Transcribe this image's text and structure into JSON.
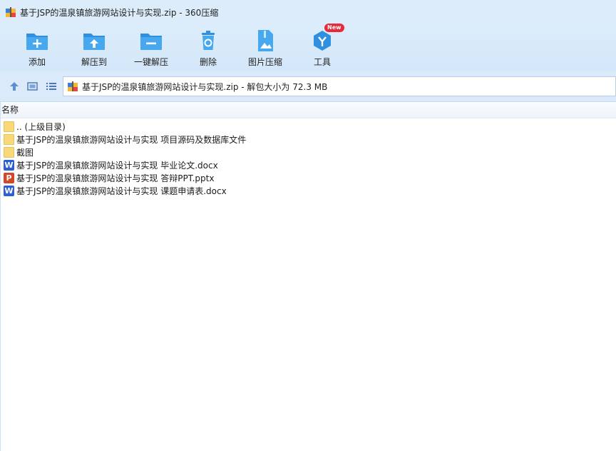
{
  "window": {
    "title": "基于JSP的温泉镇旅游网站设计与实现.zip - 360压缩",
    "icon": "zip-archive-icon"
  },
  "toolbar": {
    "add_label": "添加",
    "extract_label": "解压到",
    "one_click_extract_label": "一键解压",
    "delete_label": "删除",
    "image_compress_label": "图片压缩",
    "tools_label": "工具",
    "tools_badge": "New",
    "accent_color": "#3aa0ea"
  },
  "navbar": {
    "up_icon": "up-arrow-icon",
    "thumbnail_view_icon": "thumbnail-view-icon",
    "list_view_icon": "list-view-icon",
    "address": "基于JSP的温泉镇旅游网站设计与实现.zip - 解包大小为 72.3 MB"
  },
  "file_list": {
    "column_name": "名称",
    "items": [
      {
        "name": ".. (上级目录)",
        "type": "folder"
      },
      {
        "name": "基于JSP的温泉镇旅游网站设计与实现 项目源码及数据库文件",
        "type": "folder"
      },
      {
        "name": "截图",
        "type": "folder"
      },
      {
        "name": "基于JSP的温泉镇旅游网站设计与实现 毕业论文.docx",
        "type": "docx",
        "glyph": "W"
      },
      {
        "name": "基于JSP的温泉镇旅游网站设计与实现 答辩PPT.pptx",
        "type": "pptx",
        "glyph": "P"
      },
      {
        "name": "基于JSP的温泉镇旅游网站设计与实现 课题申请表.docx",
        "type": "docx",
        "glyph": "W"
      }
    ]
  }
}
